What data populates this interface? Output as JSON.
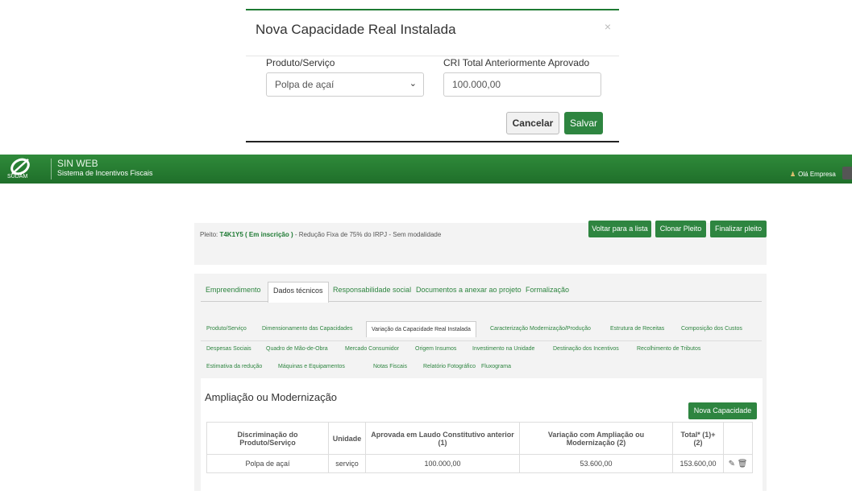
{
  "modal": {
    "title": "Nova Capacidade Real Instalada",
    "close": "×",
    "product_label": "Produto/Serviço",
    "product_value": "Polpa de açaí",
    "cri_label": "CRI Total Anteriormente Aprovado",
    "cri_value": "100.000,00",
    "cancel": "Cancelar",
    "save": "Salvar"
  },
  "header": {
    "logo_text": "SUDAM",
    "app_title": "SIN WEB",
    "app_subtitle": "Sistema de Incentivos Fiscais",
    "user": "Olá Empresa"
  },
  "actions": {
    "back": "Voltar para a lista",
    "clone": "Clonar Pleito",
    "finish": "Finalizar pleito"
  },
  "pleito": {
    "prefix": "Pleito:",
    "code": "T4K1Y5 ( Em inscrição )",
    "desc": "- Redução Fixa de 75% do IRPJ - Sem modalidade"
  },
  "tabs": [
    "Empreendimento",
    "Dados técnicos",
    "Responsabilidade social",
    "Documentos a anexar ao projeto",
    "Formalização"
  ],
  "subtabs": {
    "row1": [
      "Produto/Serviço",
      "Dimensionamento das Capacidades",
      "Variação da Capacidade Real Instalada",
      "Caracterização Modernização/Produção",
      "Estrutura de Receitas",
      "Composição dos Custos"
    ],
    "row2": [
      "Despesas Sociais",
      "Quadro de Mão-de-Obra",
      "Mercado Consumidor",
      "Origem Insumos",
      "Investimento na Unidade",
      "Destinação dos Incentivos",
      "Recolhimento de Tributos"
    ],
    "row3": [
      "Estimativa da redução",
      "Máquinas e Equipamentos",
      "Notas Fiscais",
      "Relatório Fotográfico",
      "Fluxograma"
    ]
  },
  "section": {
    "title": "Ampliação ou Modernização",
    "new_button": "Nova Capacidade"
  },
  "table": {
    "headers": [
      "Discriminação do Produto/Serviço",
      "Unidade",
      "Aprovada em Laudo Constitutivo anterior (1)",
      "Variação com Ampliação ou Modernização (2)",
      "Total* (1)+(2)",
      ""
    ],
    "rows": [
      [
        "Polpa de açaí",
        "serviço",
        "100.000,00",
        "53.600,00",
        "153.600,00"
      ]
    ]
  }
}
